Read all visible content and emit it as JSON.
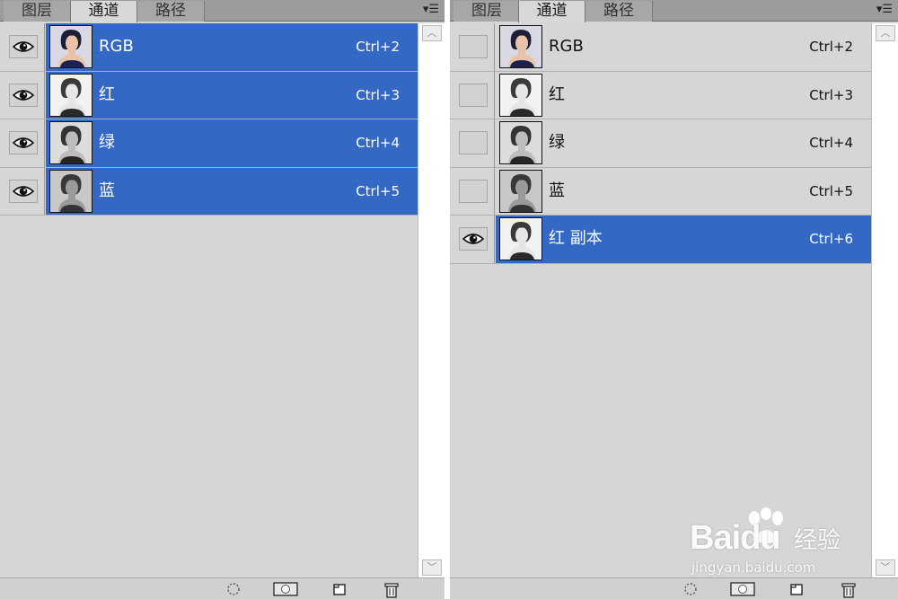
{
  "tabs": [
    "图层",
    "通道",
    "路径"
  ],
  "active_tab": 1,
  "panels": {
    "left": {
      "channels": [
        {
          "name": "RGB",
          "shortcut": "Ctrl+2",
          "visible": true,
          "selected": true,
          "thumb": "color"
        },
        {
          "name": "红",
          "shortcut": "Ctrl+3",
          "visible": true,
          "selected": true,
          "thumb": "gray-light"
        },
        {
          "name": "绿",
          "shortcut": "Ctrl+4",
          "visible": true,
          "selected": true,
          "thumb": "gray-mid"
        },
        {
          "name": "蓝",
          "shortcut": "Ctrl+5",
          "visible": true,
          "selected": true,
          "thumb": "gray-dark"
        }
      ]
    },
    "right": {
      "channels": [
        {
          "name": "RGB",
          "shortcut": "Ctrl+2",
          "visible": false,
          "selected": false,
          "thumb": "color"
        },
        {
          "name": "红",
          "shortcut": "Ctrl+3",
          "visible": false,
          "selected": false,
          "thumb": "gray-light"
        },
        {
          "name": "绿",
          "shortcut": "Ctrl+4",
          "visible": false,
          "selected": false,
          "thumb": "gray-mid"
        },
        {
          "name": "蓝",
          "shortcut": "Ctrl+5",
          "visible": false,
          "selected": false,
          "thumb": "gray-dark"
        },
        {
          "name": "红 副本",
          "shortcut": "Ctrl+6",
          "visible": true,
          "selected": true,
          "thumb": "gray-light"
        }
      ]
    }
  },
  "bottom_icons": [
    "load-selection-icon",
    "save-selection-icon",
    "new-channel-icon",
    "delete-channel-icon"
  ],
  "watermark": {
    "logo": "Baidu",
    "cn": "经验",
    "url": "jingyan.baidu.com"
  },
  "colors": {
    "panel_bg": "#d6d6d6",
    "tab_bar": "#9c9c9c",
    "selection": "#3369c4",
    "text_selected": "#ffffff",
    "text_normal": "#111111"
  }
}
